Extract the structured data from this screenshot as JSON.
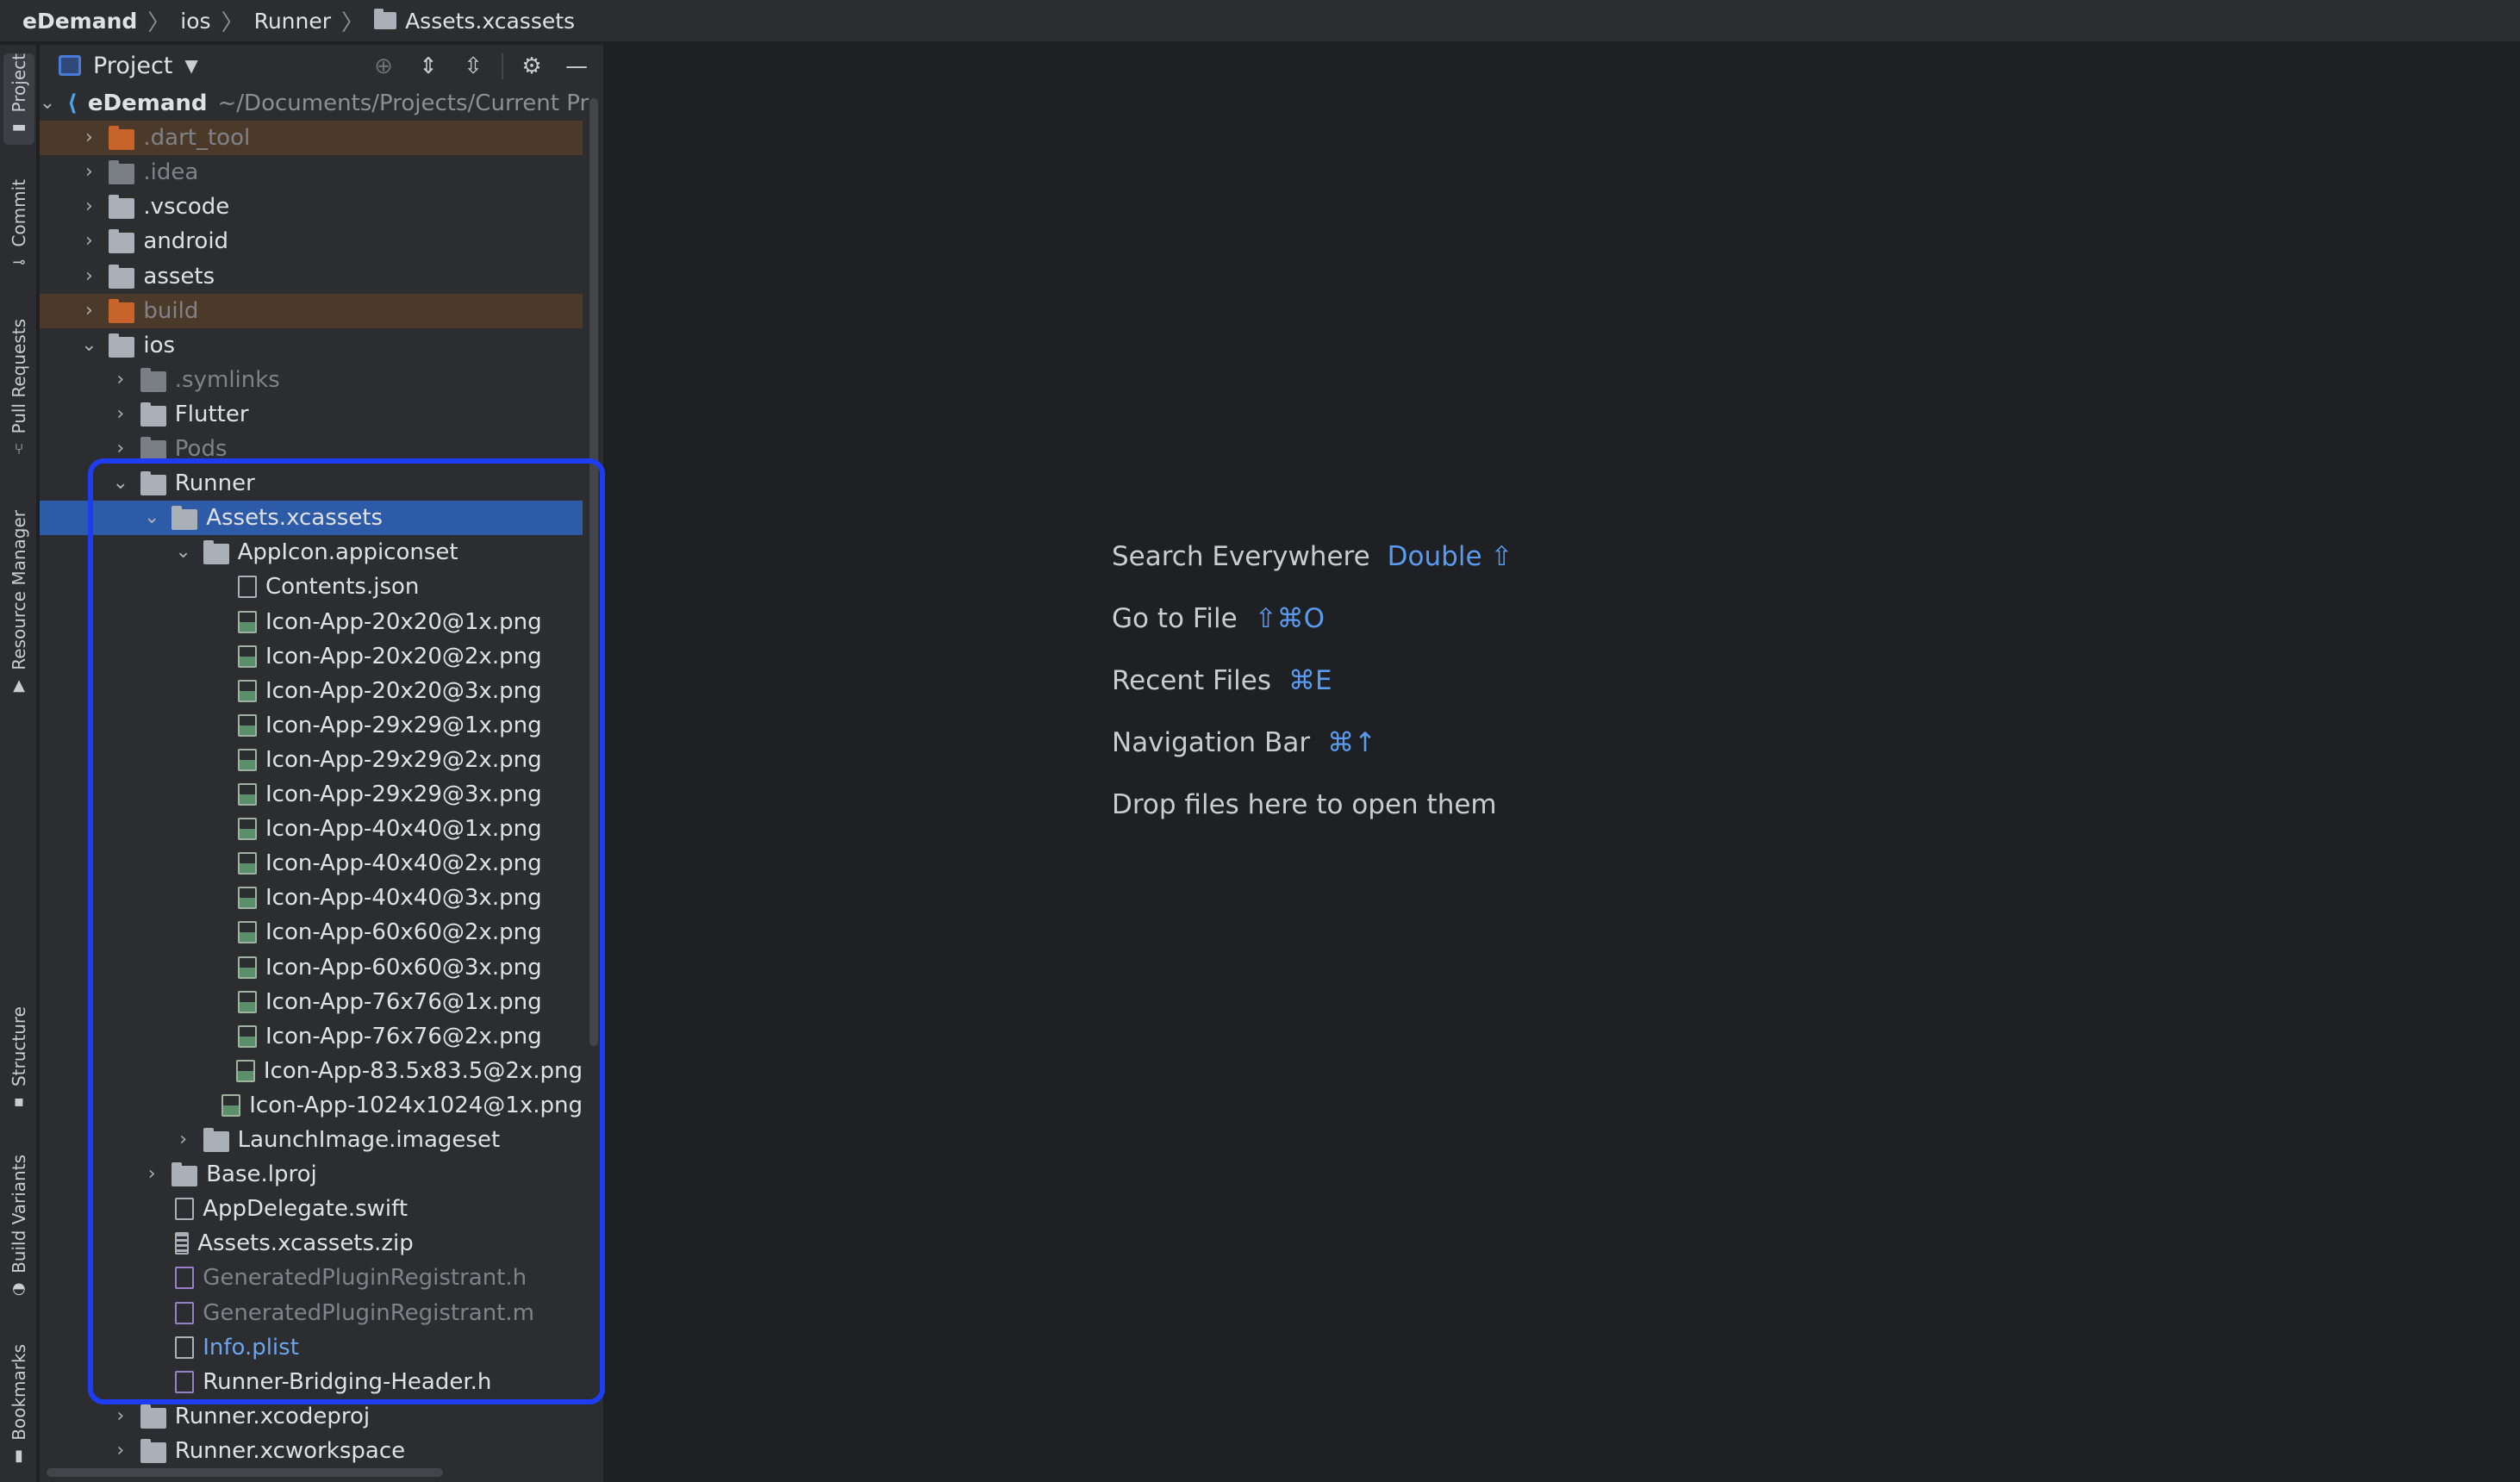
{
  "breadcrumb": {
    "items": [
      "eDemand",
      "ios",
      "Runner",
      "Assets.xcassets"
    ],
    "separator": "〉"
  },
  "tool_windows": {
    "left": [
      "Project",
      "Commit",
      "Pull Requests",
      "Resource Manager",
      "Structure",
      "Build Variants",
      "Bookmarks"
    ]
  },
  "project_panel": {
    "title": "Project",
    "root": {
      "name": "eDemand",
      "path": "~/Documents/Projects/Current Pr"
    },
    "tree": [
      {
        "label": "eDemand",
        "path": "~/Documents/Projects/Current Pr",
        "depth": 0,
        "expanded": true,
        "kind": "root"
      },
      {
        "label": ".dart_tool",
        "depth": 1,
        "expanded": false,
        "kind": "folder-excluded"
      },
      {
        "label": ".idea",
        "depth": 1,
        "expanded": false,
        "kind": "folder-muted"
      },
      {
        "label": ".vscode",
        "depth": 1,
        "expanded": false,
        "kind": "folder"
      },
      {
        "label": "android",
        "depth": 1,
        "expanded": false,
        "kind": "folder"
      },
      {
        "label": "assets",
        "depth": 1,
        "expanded": false,
        "kind": "folder"
      },
      {
        "label": "build",
        "depth": 1,
        "expanded": false,
        "kind": "folder-excluded"
      },
      {
        "label": "ios",
        "depth": 1,
        "expanded": true,
        "kind": "folder"
      },
      {
        "label": ".symlinks",
        "depth": 2,
        "expanded": false,
        "kind": "folder-muted"
      },
      {
        "label": "Flutter",
        "depth": 2,
        "expanded": false,
        "kind": "folder"
      },
      {
        "label": "Pods",
        "depth": 2,
        "expanded": false,
        "kind": "folder-muted"
      },
      {
        "label": "Runner",
        "depth": 2,
        "expanded": true,
        "kind": "folder"
      },
      {
        "label": "Assets.xcassets",
        "depth": 3,
        "expanded": true,
        "kind": "folder-selected"
      },
      {
        "label": "AppIcon.appiconset",
        "depth": 4,
        "expanded": true,
        "kind": "folder"
      },
      {
        "label": "Contents.json",
        "depth": 5,
        "kind": "json"
      },
      {
        "label": "Icon-App-20x20@1x.png",
        "depth": 5,
        "kind": "img"
      },
      {
        "label": "Icon-App-20x20@2x.png",
        "depth": 5,
        "kind": "img"
      },
      {
        "label": "Icon-App-20x20@3x.png",
        "depth": 5,
        "kind": "img"
      },
      {
        "label": "Icon-App-29x29@1x.png",
        "depth": 5,
        "kind": "img"
      },
      {
        "label": "Icon-App-29x29@2x.png",
        "depth": 5,
        "kind": "img"
      },
      {
        "label": "Icon-App-29x29@3x.png",
        "depth": 5,
        "kind": "img"
      },
      {
        "label": "Icon-App-40x40@1x.png",
        "depth": 5,
        "kind": "img"
      },
      {
        "label": "Icon-App-40x40@2x.png",
        "depth": 5,
        "kind": "img"
      },
      {
        "label": "Icon-App-40x40@3x.png",
        "depth": 5,
        "kind": "img"
      },
      {
        "label": "Icon-App-60x60@2x.png",
        "depth": 5,
        "kind": "img"
      },
      {
        "label": "Icon-App-60x60@3x.png",
        "depth": 5,
        "kind": "img"
      },
      {
        "label": "Icon-App-76x76@1x.png",
        "depth": 5,
        "kind": "img"
      },
      {
        "label": "Icon-App-76x76@2x.png",
        "depth": 5,
        "kind": "img"
      },
      {
        "label": "Icon-App-83.5x83.5@2x.png",
        "depth": 5,
        "kind": "img"
      },
      {
        "label": "Icon-App-1024x1024@1x.png",
        "depth": 5,
        "kind": "img"
      },
      {
        "label": "LaunchImage.imageset",
        "depth": 4,
        "expanded": false,
        "kind": "folder"
      },
      {
        "label": "Base.lproj",
        "depth": 3,
        "expanded": false,
        "kind": "folder"
      },
      {
        "label": "AppDelegate.swift",
        "depth": 3,
        "kind": "file"
      },
      {
        "label": "Assets.xcassets.zip",
        "depth": 3,
        "kind": "zip"
      },
      {
        "label": "GeneratedPluginRegistrant.h",
        "depth": 3,
        "kind": "code-muted"
      },
      {
        "label": "GeneratedPluginRegistrant.m",
        "depth": 3,
        "kind": "code-muted"
      },
      {
        "label": "Info.plist",
        "depth": 3,
        "kind": "plist"
      },
      {
        "label": "Runner-Bridging-Header.h",
        "depth": 3,
        "kind": "code"
      },
      {
        "label": "Runner.xcodeproj",
        "depth": 2,
        "expanded": false,
        "kind": "folder"
      },
      {
        "label": "Runner.xcworkspace",
        "depth": 2,
        "expanded": false,
        "kind": "folder"
      }
    ]
  },
  "editor": {
    "hints": [
      {
        "label": "Search Everywhere",
        "shortcut": "Double ⇧"
      },
      {
        "label": "Go to File",
        "shortcut": "⇧⌘O"
      },
      {
        "label": "Recent Files",
        "shortcut": "⌘E"
      },
      {
        "label": "Navigation Bar",
        "shortcut": "⌘↑"
      },
      {
        "label": "Drop files here to open them",
        "shortcut": ""
      }
    ]
  },
  "colors": {
    "accent": "#5a9bf0",
    "selection": "#2e5ba8",
    "highlight_box": "#1f3cf5",
    "excluded_bg": "#4b3a2a"
  }
}
